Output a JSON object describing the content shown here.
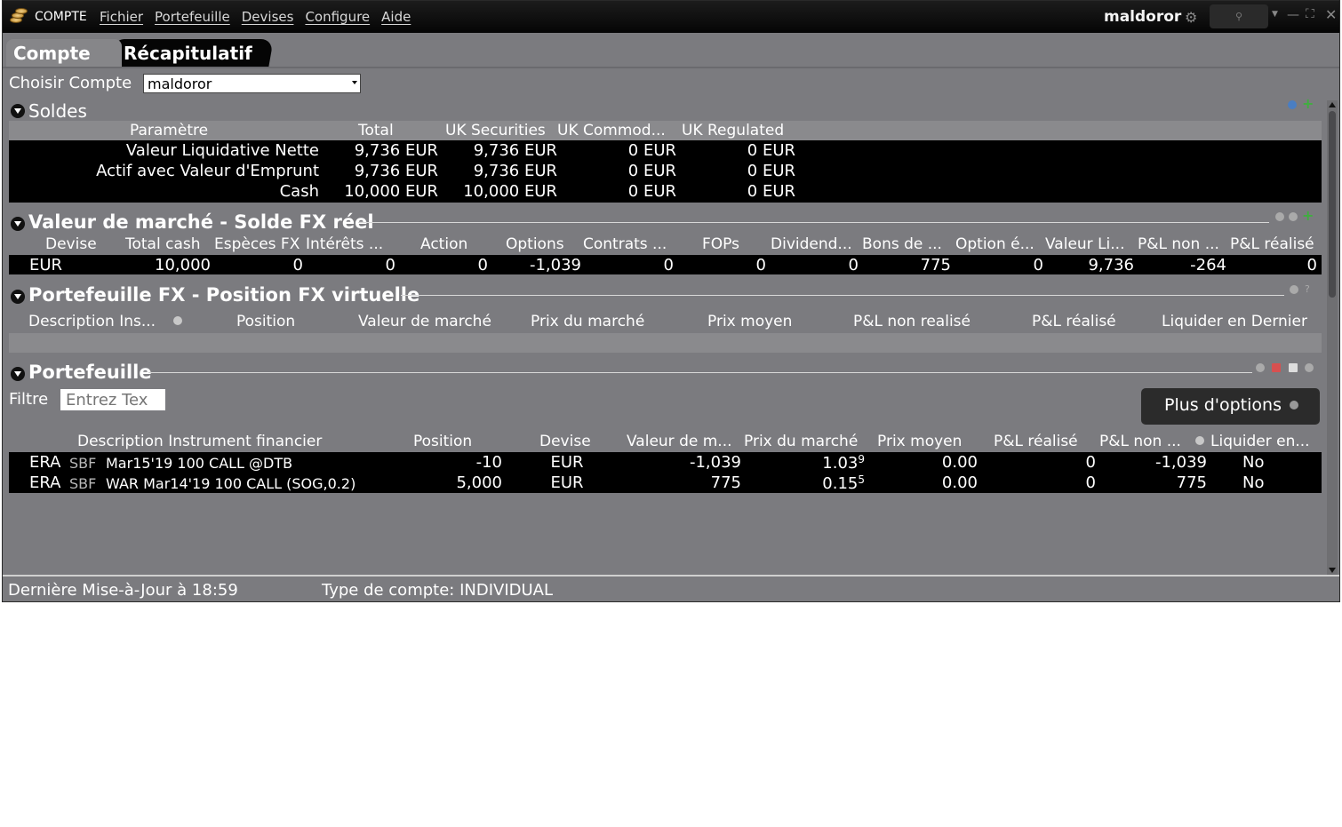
{
  "app": {
    "name": "COMPTE",
    "user": "maldoror"
  },
  "menu": [
    "Fichier",
    "Portefeuille",
    "Devises",
    "Configure",
    "Aide"
  ],
  "tabs": {
    "active": "Compte",
    "other": "Récapitulatif"
  },
  "account": {
    "label": "Choisir Compte",
    "selected": "maldoror"
  },
  "soldes": {
    "title": "Soldes",
    "headers": [
      "Paramètre",
      "Total",
      "UK Securities",
      "UK Commod...",
      "UK Regulated"
    ],
    "rows": [
      [
        "Valeur Liquidative Nette",
        "9,736 EUR",
        "9,736 EUR",
        "0 EUR",
        "0 EUR"
      ],
      [
        "Actif avec Valeur d'Emprunt",
        "9,736 EUR",
        "9,736 EUR",
        "0 EUR",
        "0 EUR"
      ],
      [
        "Cash",
        "10,000 EUR",
        "10,000 EUR",
        "0 EUR",
        "0 EUR"
      ]
    ]
  },
  "market": {
    "title": "Valeur de marché - Solde FX réel",
    "headers": [
      "Devise",
      "Total cash",
      "Espèces FX",
      "Intérêts ...",
      "Action",
      "Options",
      "Contrats ...",
      "FOPs",
      "Dividend...",
      "Bons de ...",
      "Option é...",
      "Valeur Li...",
      "P&L non ...",
      "P&L réalisé"
    ],
    "row": [
      "EUR",
      "10,000",
      "0",
      "0",
      "0",
      "-1,039",
      "0",
      "0",
      "0",
      "775",
      "0",
      "9,736",
      "-264",
      "0"
    ]
  },
  "fx": {
    "title": "Portefeuille FX - Position FX virtuelle",
    "headers": [
      "Description Ins...",
      "Position",
      "Valeur de marché",
      "Prix du marché",
      "Prix moyen",
      "P&L non realisé",
      "P&L réalisé",
      "Liquider en Dernier"
    ]
  },
  "portfolio": {
    "title": "Portefeuille",
    "filter_label": "Filtre",
    "filter_placeholder": "Entrez Tex",
    "more_options": "Plus d'options",
    "headers": [
      "Description Instrument financier",
      "Position",
      "Devise",
      "Valeur de m...",
      "Prix du marché",
      "Prix moyen",
      "P&L réalisé",
      "P&L non ...",
      "Liquider en..."
    ],
    "rows": [
      {
        "symbol": "ERA",
        "exchange": "SBF",
        "desc": "Mar15'19 100 CALL @DTB",
        "position": "-10",
        "currency": "EUR",
        "value": "-1,039",
        "price_main": "1.03",
        "price_sup": "9",
        "avg": "0.00",
        "realized": "0",
        "unrealized": "-1,039",
        "liquidate": "No"
      },
      {
        "symbol": "ERA",
        "exchange": "SBF",
        "desc": "WAR Mar14'19 100 CALL (SOG,0.2)",
        "position": "5,000",
        "currency": "EUR",
        "value": "775",
        "price_main": "0.15",
        "price_sup": "5",
        "avg": "0.00",
        "realized": "0",
        "unrealized": "775",
        "liquidate": "No"
      }
    ]
  },
  "status": {
    "last_update": "Dernière Mise-à-Jour à 18:59",
    "account_type": "Type de compte: INDIVIDUAL"
  },
  "icons": [
    "coins-logo-icon",
    "gear-icon",
    "link-icon",
    "minimize-icon",
    "maximize-icon",
    "close-icon",
    "help-icon",
    "add-icon",
    "search-icon",
    "sort-icon"
  ],
  "colors": {
    "panel": "#7b7b7f",
    "titlebar": "#0a0a0a",
    "rows": "#000000",
    "text": "#ffffff"
  }
}
